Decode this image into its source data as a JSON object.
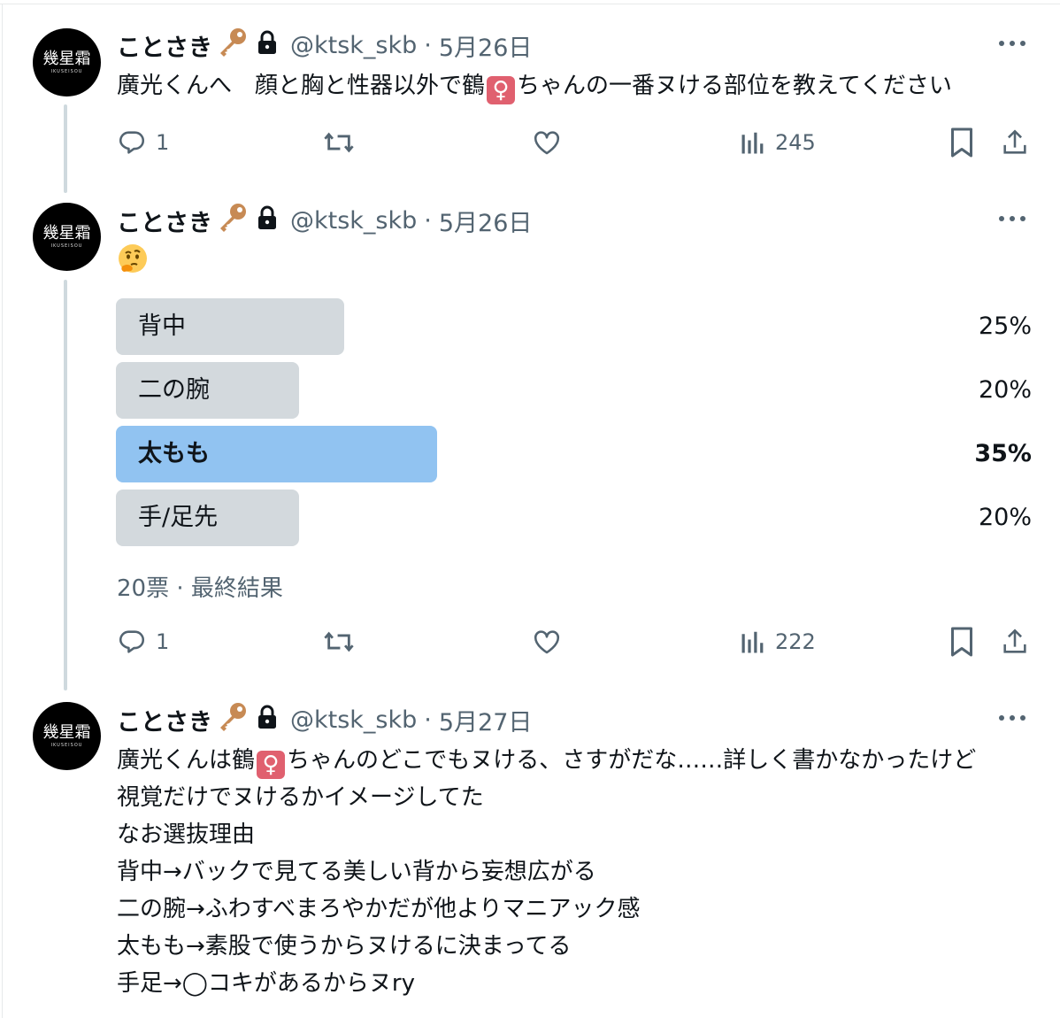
{
  "tweets": [
    {
      "avatar": {
        "main": "幾星霜",
        "sub": "IKUSEISOU"
      },
      "name": "ことさき",
      "handle": "@ktsk_skb",
      "separator": "·",
      "date": "5月26日",
      "text": {
        "part1": "廣光くんへ　顔と胸と性器以外で鶴",
        "emoji": "♀",
        "part2": "ちゃんの一番ヌける部位を教えてください"
      },
      "actions": {
        "replies": "1",
        "views": "245"
      }
    },
    {
      "avatar": {
        "main": "幾星霜",
        "sub": "IKUSEISOU"
      },
      "name": "ことさき",
      "handle": "@ktsk_skb",
      "separator": "·",
      "date": "5月26日",
      "emoji_text": "thinking-face",
      "poll": {
        "options": [
          {
            "label": "背中",
            "percent": "25%",
            "value": 25
          },
          {
            "label": "二の腕",
            "percent": "20%",
            "value": 20
          },
          {
            "label": "太もも",
            "percent": "35%",
            "value": 35
          },
          {
            "label": "手/足先",
            "percent": "20%",
            "value": 20
          }
        ],
        "meta": "20票 · 最終結果"
      },
      "actions": {
        "replies": "1",
        "views": "222"
      }
    },
    {
      "avatar": {
        "main": "幾星霜",
        "sub": "IKUSEISOU"
      },
      "name": "ことさき",
      "handle": "@ktsk_skb",
      "separator": "·",
      "date": "5月27日",
      "text": {
        "line1_part1": "廣光くんは鶴",
        "emoji": "♀",
        "line1_part2": "ちゃんのどこでもヌける、さすがだな……詳しく書かなかったけど",
        "line2": "視覚だけでヌけるかイメージしてた",
        "line3": "なお選抜理由",
        "line4": "背中→バックで見てる美しい背から妄想広がる",
        "line5": "二の腕→ふわすべまろやかだが他よりマニアック感",
        "line6": "太もも→素股で使うからヌけるに決まってる",
        "line7": "手足→◯コキがあるからヌry"
      }
    }
  ],
  "colors": {
    "poll_winner": "#91c3f1",
    "poll_other": "#d3d9dd",
    "secondary_text": "#536471",
    "female_emoji_bg": "#e0606f"
  }
}
